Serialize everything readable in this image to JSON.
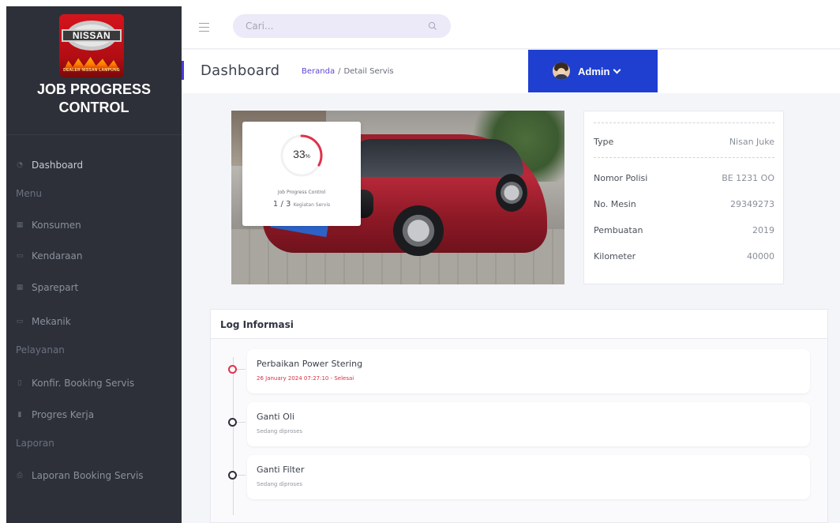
{
  "brand": {
    "logo_word": "NISSAN",
    "logo_sub": "DEALER NISSAN LAMPUNG",
    "title_line1": "JOB PROGRESS",
    "title_line2": "CONTROL"
  },
  "sidebar": {
    "items": [
      {
        "label": "Dashboard",
        "icon": "dashboard-icon"
      },
      {
        "heading": "Menu"
      },
      {
        "label": "Konsumen",
        "icon": "users-icon"
      },
      {
        "label": "Kendaraan",
        "icon": "car-icon"
      },
      {
        "label": "Sparepart",
        "icon": "box-icon"
      },
      {
        "label": "Mekanik",
        "icon": "wrench-icon"
      },
      {
        "heading": "Pelayanan"
      },
      {
        "label": "Konfir. Booking Servis",
        "icon": "document-icon"
      },
      {
        "label": "Progres Kerja",
        "icon": "bar-chart-icon"
      },
      {
        "heading": "Laporan"
      },
      {
        "label": "Laporan Booking Servis",
        "icon": "print-icon"
      }
    ]
  },
  "topbar": {
    "search_placeholder": "Cari...",
    "user_label": "Admin"
  },
  "header": {
    "page_title": "Dashboard",
    "breadcrumb_home": "Beranda",
    "breadcrumb_sep": "/",
    "breadcrumb_current": "Detail Servis"
  },
  "progress": {
    "percent_value": 33,
    "percent": "33",
    "percent_unit": "%",
    "label": "Job Progress Control",
    "done": "1",
    "sep": "/",
    "total": "3",
    "unit": "Kegiatan Servis"
  },
  "vehicle": {
    "rows": [
      {
        "key": "Type",
        "value": "Nisan Juke"
      },
      {
        "key": "Nomor Polisi",
        "value": "BE 1231 OO"
      },
      {
        "key": "No. Mesin",
        "value": "29349273"
      },
      {
        "key": "Pembuatan",
        "value": "2019"
      },
      {
        "key": "Kilometer",
        "value": "40000"
      }
    ]
  },
  "log": {
    "title": "Log Informasi",
    "items": [
      {
        "name": "Perbaikan Power Stering",
        "status": "26 January 2024 07:27:10 - Selesai",
        "state": "done"
      },
      {
        "name": "Ganti Oli",
        "status": "Sedang diproses",
        "state": "pending"
      },
      {
        "name": "Ganti Filter",
        "status": "Sedang diproses",
        "state": "pending"
      }
    ]
  },
  "colors": {
    "accent": "#1f3fd1",
    "progress": "#e0314b",
    "sidebar": "#2d3038"
  }
}
